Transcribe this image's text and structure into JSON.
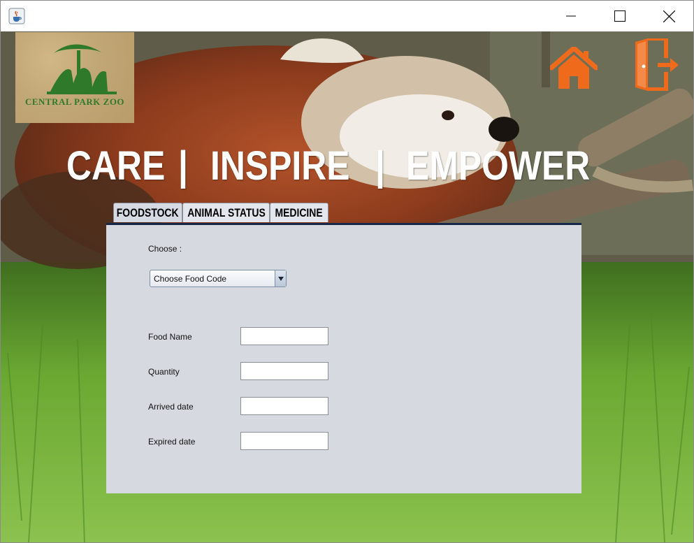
{
  "titlebar": {
    "app_icon": "java-cup-icon",
    "controls": {
      "minimize": "minimize-icon",
      "maximize": "maximize-icon",
      "close": "close-icon"
    }
  },
  "header": {
    "logo_text": "CENTRAL PARK ZOO",
    "slogan": {
      "word1": "CARE",
      "sep": "|",
      "word2": "INSPIRE",
      "word3": "EMPOWER"
    },
    "home_icon": "home-icon",
    "exit_icon": "exit-door-icon",
    "accent_color": "#f06a1b"
  },
  "tabs": [
    {
      "label": "FOODSTOCK",
      "selected": true
    },
    {
      "label": "ANIMAL STATUS",
      "selected": false
    },
    {
      "label": "MEDICINE",
      "selected": false
    }
  ],
  "foodstock": {
    "choose_label": "Choose :",
    "combo": {
      "selected": "Choose Food Code",
      "arrow_icon": "chevron-down-icon"
    },
    "fields": [
      {
        "label": "Food Name",
        "value": ""
      },
      {
        "label": "Quantity",
        "value": ""
      },
      {
        "label": "Arrived date",
        "value": ""
      },
      {
        "label": "Expired date",
        "value": ""
      }
    ]
  }
}
